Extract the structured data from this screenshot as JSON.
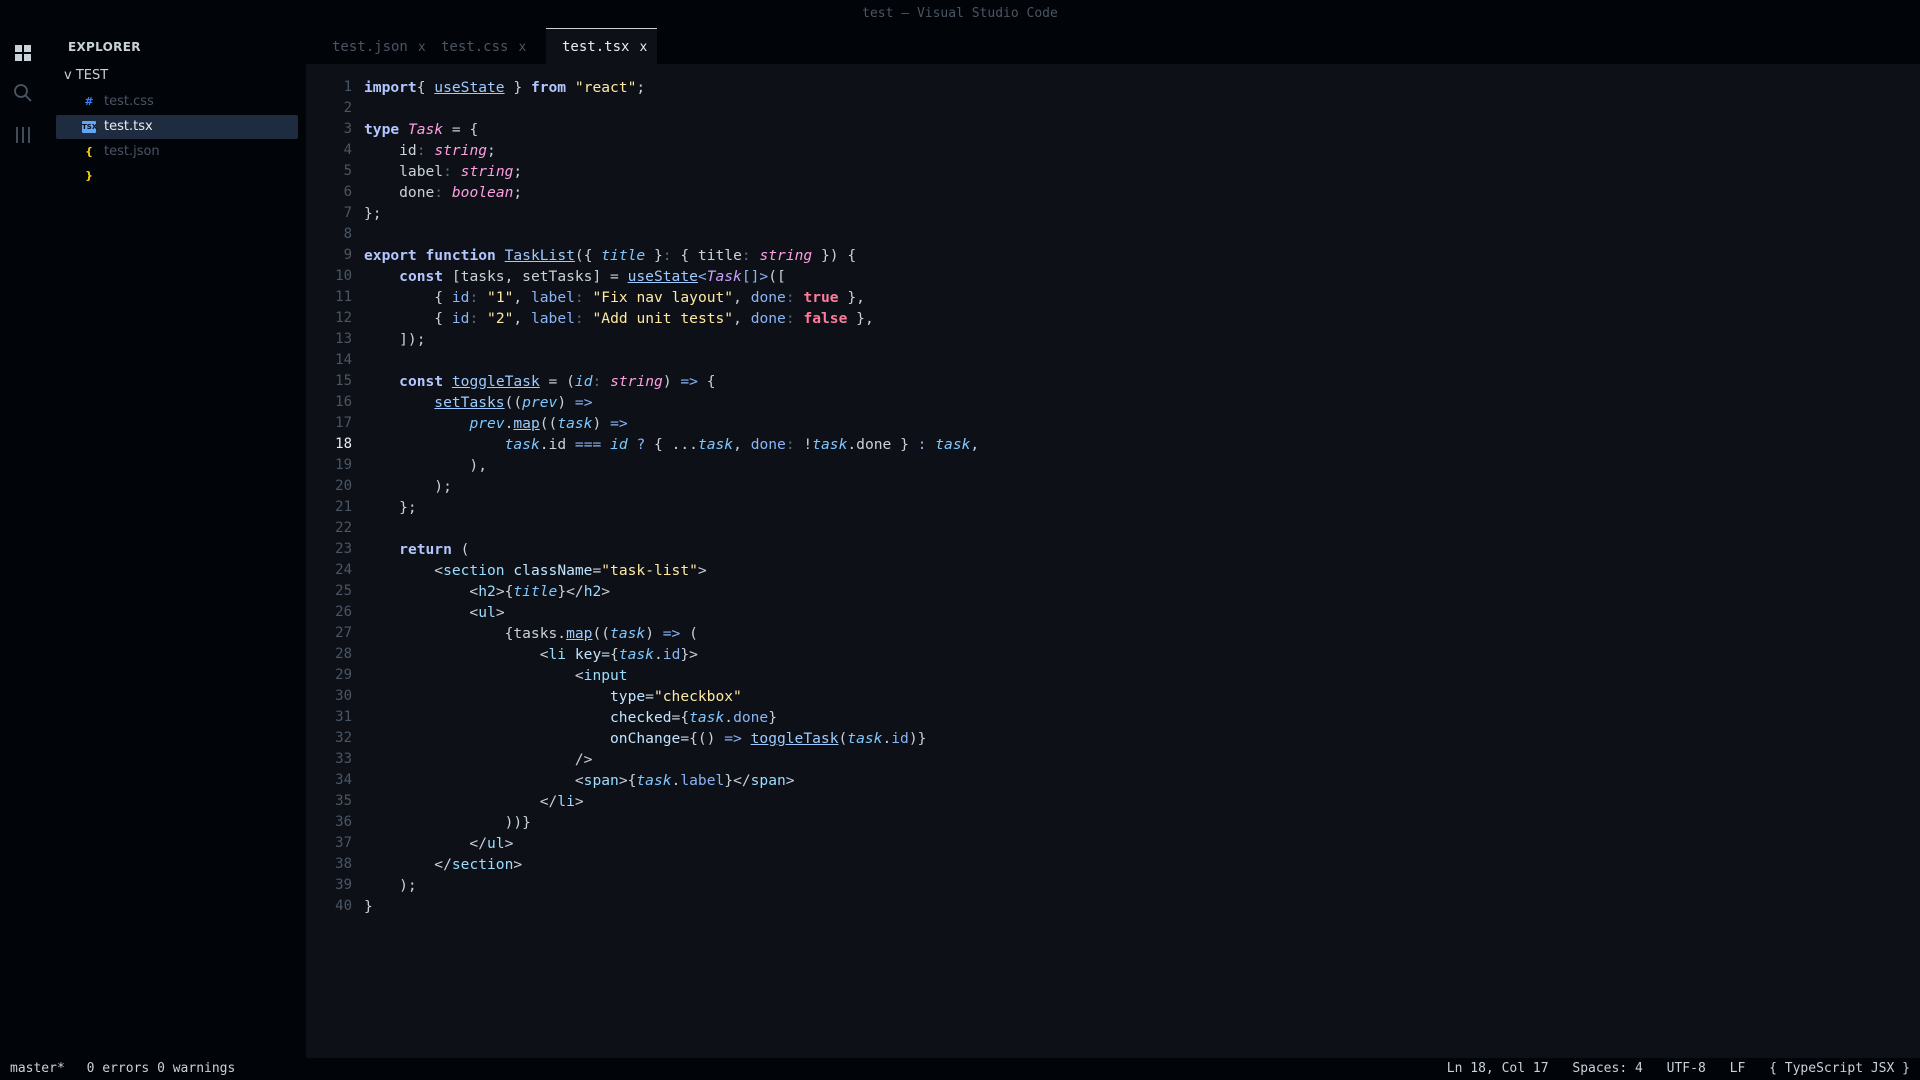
{
  "window": {
    "title": "test — Visual Studio Code"
  },
  "activity_bar": {
    "icons": [
      "explorer-icon",
      "search-icon",
      "extensions-icon"
    ]
  },
  "sidebar": {
    "title": "EXPLORER",
    "folder": "v TEST",
    "files": [
      {
        "icon": "#",
        "name": "test.css",
        "icon_color": "#3b82f6",
        "active": false
      },
      {
        "icon": "TSX",
        "name": "test.tsx",
        "icon_color": "#60a5fa",
        "active": true
      },
      {
        "icon": "{ }",
        "name": "test.json",
        "icon_color": "#facc15",
        "active": false
      }
    ]
  },
  "tabs": [
    {
      "label": "test.json",
      "close": "x",
      "active": false
    },
    {
      "label": "test.css",
      "close": "x",
      "active": false
    },
    {
      "label": "test.tsx",
      "close": "x",
      "active": true
    }
  ],
  "editor": {
    "current_line": 18,
    "lines": [
      [
        [
          "kw",
          "import"
        ],
        [
          "",
          "{ "
        ],
        [
          "fn",
          "useState"
        ],
        [
          "",
          " } "
        ],
        [
          "kw",
          "from"
        ],
        [
          "",
          " "
        ],
        [
          "st",
          "\"react\""
        ],
        [
          "",
          ";"
        ]
      ],
      [],
      [
        [
          "kw",
          "type"
        ],
        [
          "",
          " "
        ],
        [
          "ty",
          "Task"
        ],
        [
          "",
          " = {"
        ]
      ],
      [
        [
          "",
          "    id"
        ],
        [
          "cm",
          ":"
        ],
        [
          "",
          " "
        ],
        [
          "ty",
          "string"
        ],
        [
          "",
          ";"
        ]
      ],
      [
        [
          "",
          "    label"
        ],
        [
          "cm",
          ":"
        ],
        [
          "",
          " "
        ],
        [
          "ty",
          "string"
        ],
        [
          "",
          ";"
        ]
      ],
      [
        [
          "",
          "    done"
        ],
        [
          "cm",
          ":"
        ],
        [
          "",
          " "
        ],
        [
          "ty",
          "boolean"
        ],
        [
          "",
          ";"
        ]
      ],
      [
        [
          "",
          "};"
        ]
      ],
      [],
      [
        [
          "kw",
          "export"
        ],
        [
          "",
          " "
        ],
        [
          "kw",
          "function"
        ],
        [
          "",
          " "
        ],
        [
          "fn",
          "TaskList"
        ],
        [
          "",
          "({ "
        ],
        [
          "pm",
          "title"
        ],
        [
          "",
          " }"
        ],
        [
          "cm",
          ":"
        ],
        [
          "",
          " { title"
        ],
        [
          "cm",
          ":"
        ],
        [
          "",
          " "
        ],
        [
          "ty",
          "string"
        ],
        [
          "",
          " }) {"
        ]
      ],
      [
        [
          "",
          "    "
        ],
        [
          "kw",
          "const"
        ],
        [
          "",
          " [tasks, setTasks] = "
        ],
        [
          "fn",
          "useState"
        ],
        [
          "pr",
          "<"
        ],
        [
          "ta",
          "Task"
        ],
        [
          "pr",
          "[]>"
        ],
        [
          "",
          "(["
        ]
      ],
      [
        [
          "",
          "        { "
        ],
        [
          "pr",
          "id"
        ],
        [
          "cm",
          ":"
        ],
        [
          "",
          " "
        ],
        [
          "st",
          "\"1\""
        ],
        [
          "",
          ", "
        ],
        [
          "pr",
          "label"
        ],
        [
          "cm",
          ":"
        ],
        [
          "",
          " "
        ],
        [
          "st",
          "\"Fix nav layout\""
        ],
        [
          "",
          ", "
        ],
        [
          "pr",
          "done"
        ],
        [
          "cm",
          ":"
        ],
        [
          "",
          " "
        ],
        [
          "bt",
          "true"
        ],
        [
          "",
          " },"
        ]
      ],
      [
        [
          "",
          "        { "
        ],
        [
          "pr",
          "id"
        ],
        [
          "cm",
          ":"
        ],
        [
          "",
          " "
        ],
        [
          "st",
          "\"2\""
        ],
        [
          "",
          ", "
        ],
        [
          "pr",
          "label"
        ],
        [
          "cm",
          ":"
        ],
        [
          "",
          " "
        ],
        [
          "st",
          "\"Add unit tests\""
        ],
        [
          "",
          ", "
        ],
        [
          "pr",
          "done"
        ],
        [
          "cm",
          ":"
        ],
        [
          "",
          " "
        ],
        [
          "bt",
          "false"
        ],
        [
          "",
          " },"
        ]
      ],
      [
        [
          "",
          "    ]);"
        ]
      ],
      [],
      [
        [
          "",
          "    "
        ],
        [
          "kw",
          "const"
        ],
        [
          "",
          " "
        ],
        [
          "fn",
          "toggleTask"
        ],
        [
          "",
          " = ("
        ],
        [
          "pm",
          "id"
        ],
        [
          "cm",
          ":"
        ],
        [
          "",
          " "
        ],
        [
          "ty",
          "string"
        ],
        [
          "",
          ") "
        ],
        [
          "pr",
          "=>"
        ],
        [
          "",
          " {"
        ]
      ],
      [
        [
          "",
          "        "
        ],
        [
          "fn",
          "setTasks"
        ],
        [
          "",
          "(("
        ],
        [
          "pm",
          "prev"
        ],
        [
          "",
          ") "
        ],
        [
          "pr",
          "=>"
        ]
      ],
      [
        [
          "",
          "            "
        ],
        [
          "pm",
          "prev"
        ],
        [
          "",
          "."
        ],
        [
          "fn",
          "map"
        ],
        [
          "",
          "(("
        ],
        [
          "pm",
          "task"
        ],
        [
          "",
          ") "
        ],
        [
          "pr",
          "=>"
        ]
      ],
      [
        [
          "",
          "                "
        ],
        [
          "pm",
          "task"
        ],
        [
          "",
          ".id "
        ],
        [
          "pr",
          "==="
        ],
        [
          "",
          " "
        ],
        [
          "pm",
          "id"
        ],
        [
          "",
          " "
        ],
        [
          "pr",
          "?"
        ],
        [
          "",
          " { ..."
        ],
        [
          "pm",
          "task"
        ],
        [
          "",
          ", "
        ],
        [
          "pr",
          "done"
        ],
        [
          "cm",
          ":"
        ],
        [
          "",
          " !"
        ],
        [
          "pm",
          "task"
        ],
        [
          "",
          ".done } "
        ],
        [
          "pr",
          ":"
        ],
        [
          "",
          " "
        ],
        [
          "pm",
          "task"
        ],
        [
          "",
          ","
        ]
      ],
      [
        [
          "",
          "            ),"
        ]
      ],
      [
        [
          "",
          "        );"
        ]
      ],
      [
        [
          "",
          "    };"
        ]
      ],
      [],
      [
        [
          "",
          "    "
        ],
        [
          "kw",
          "return"
        ],
        [
          "",
          " ("
        ]
      ],
      [
        [
          "",
          "        <"
        ],
        [
          "tg",
          "section"
        ],
        [
          "",
          " "
        ],
        [
          "at",
          "className"
        ],
        [
          "",
          "="
        ],
        [
          "st",
          "\"task-list\""
        ],
        [
          "",
          ">"
        ]
      ],
      [
        [
          "",
          "            <"
        ],
        [
          "tg",
          "h2"
        ],
        [
          "",
          ">{"
        ],
        [
          "pm",
          "title"
        ],
        [
          "",
          "}</"
        ],
        [
          "tg",
          "h2"
        ],
        [
          "",
          ">"
        ]
      ],
      [
        [
          "",
          "            <"
        ],
        [
          "tg",
          "ul"
        ],
        [
          "",
          ">"
        ]
      ],
      [
        [
          "",
          "                {tasks."
        ],
        [
          "fn",
          "map"
        ],
        [
          "",
          "(("
        ],
        [
          "pm",
          "task"
        ],
        [
          "",
          ") "
        ],
        [
          "pr",
          "=>"
        ],
        [
          "",
          " ("
        ]
      ],
      [
        [
          "",
          "                    <"
        ],
        [
          "tg",
          "li"
        ],
        [
          "",
          " "
        ],
        [
          "at",
          "key"
        ],
        [
          "",
          "={"
        ],
        [
          "pm",
          "task"
        ],
        [
          "",
          "."
        ],
        [
          "pr",
          "id"
        ],
        [
          "",
          "}>"
        ]
      ],
      [
        [
          "",
          "                        <"
        ],
        [
          "tg",
          "input"
        ]
      ],
      [
        [
          "",
          "                            "
        ],
        [
          "at",
          "type"
        ],
        [
          "",
          "="
        ],
        [
          "st",
          "\"checkbox\""
        ]
      ],
      [
        [
          "",
          "                            "
        ],
        [
          "at",
          "checked"
        ],
        [
          "",
          "={"
        ],
        [
          "pm",
          "task"
        ],
        [
          "",
          "."
        ],
        [
          "pr",
          "done"
        ],
        [
          "",
          "}"
        ]
      ],
      [
        [
          "",
          "                            "
        ],
        [
          "at",
          "onChange"
        ],
        [
          "",
          "={() "
        ],
        [
          "pr",
          "=>"
        ],
        [
          "",
          " "
        ],
        [
          "fn",
          "toggleTask"
        ],
        [
          "",
          "("
        ],
        [
          "pm",
          "task"
        ],
        [
          "",
          "."
        ],
        [
          "pr",
          "id"
        ],
        [
          "",
          ")}"
        ]
      ],
      [
        [
          "",
          "                        />"
        ]
      ],
      [
        [
          "",
          "                        <"
        ],
        [
          "tg",
          "span"
        ],
        [
          "",
          ">{"
        ],
        [
          "pm",
          "task"
        ],
        [
          "",
          "."
        ],
        [
          "pr",
          "label"
        ],
        [
          "",
          "}</"
        ],
        [
          "tg",
          "span"
        ],
        [
          "",
          ">"
        ]
      ],
      [
        [
          "",
          "                    </"
        ],
        [
          "tg",
          "li"
        ],
        [
          "",
          ">"
        ]
      ],
      [
        [
          "",
          "                ))}"
        ]
      ],
      [
        [
          "",
          "            </"
        ],
        [
          "tg",
          "ul"
        ],
        [
          "",
          ">"
        ]
      ],
      [
        [
          "",
          "        </"
        ],
        [
          "tg",
          "section"
        ],
        [
          "",
          ">"
        ]
      ],
      [
        [
          "",
          "    );"
        ]
      ],
      [
        [
          "",
          "}"
        ]
      ]
    ]
  },
  "status": {
    "branch": "master*",
    "problems": "0 errors 0 warnings",
    "position": "Ln 18, Col 17",
    "indent": "Spaces: 4",
    "encoding": "UTF-8",
    "eol": "LF",
    "language": "{ TypeScript JSX }"
  }
}
